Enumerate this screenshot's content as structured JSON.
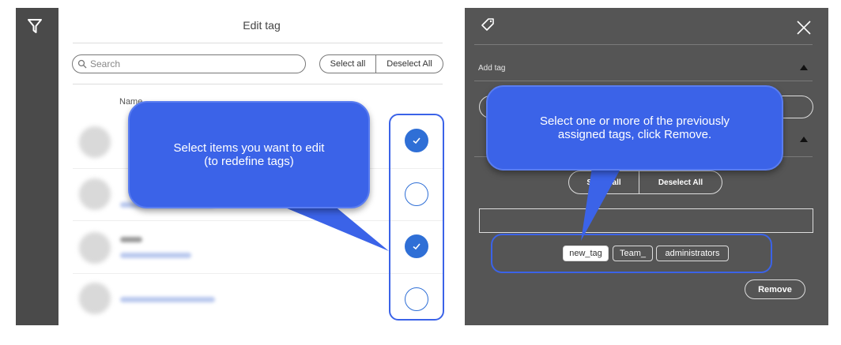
{
  "rail": {
    "filter_icon": "filter-icon"
  },
  "edit_panel": {
    "title": "Edit tag",
    "search": {
      "placeholder": "Search"
    },
    "select_all": "Select all",
    "deselect_all": "Deselect All",
    "column_name": "Name",
    "rows": [
      {
        "selected": true
      },
      {
        "selected": false
      },
      {
        "selected": true
      },
      {
        "selected": false
      }
    ]
  },
  "tag_panel": {
    "tag_icon": "tag-icon",
    "close_icon": "close-icon",
    "add_tag_label": "Add tag",
    "select_all": "Select all",
    "deselect_all": "Deselect All",
    "assigned_tags": [
      "new_tag",
      "Team_",
      "administrators"
    ],
    "remove_label": "Remove"
  },
  "callouts": {
    "left": "Select items you want to edit\n(to redefine tags)",
    "right": "Select one or more of the previously\nassigned tags, click Remove."
  },
  "colors": {
    "accent": "#3b63e8",
    "check": "#2f6fd6",
    "dark_panel": "#555555",
    "rail": "#4a4a4a"
  }
}
